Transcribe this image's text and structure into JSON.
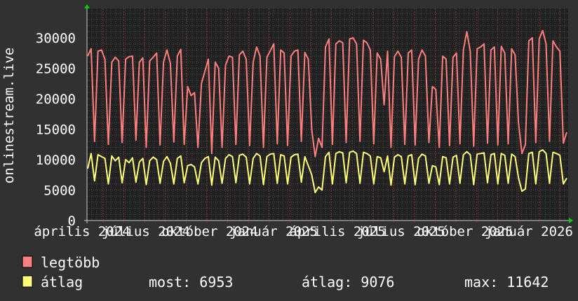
{
  "chart_data": {
    "type": "line",
    "ylabel": "onlinestream.live",
    "ylim": [
      0,
      35000
    ],
    "y_ticks": [
      "0",
      "5000",
      "10000",
      "15000",
      "20000",
      "25000",
      "30000"
    ],
    "x_tick_labels": [
      "április 2024",
      "július 2024",
      "október 2024",
      "január 2025",
      "április 2025",
      "július 2025",
      "október 2025",
      "január 2026"
    ],
    "x_range": [
      "2024-03",
      "2026-03"
    ],
    "grid": true,
    "legend_position": "bottom-left",
    "series": [
      {
        "name": "legtöbb",
        "color": "#ff7f7f",
        "values": [
          27000,
          28200,
          13000,
          27800,
          28000,
          26500,
          12500,
          26000,
          26800,
          26200,
          12800,
          26500,
          26900,
          27000,
          13200,
          26000,
          26700,
          12000,
          26200,
          26800,
          27500,
          12400,
          26000,
          28000,
          25800,
          12900,
          27000,
          28100,
          12500,
          22000,
          20500,
          21000,
          12000,
          22500,
          24500,
          26500,
          11000,
          26000,
          25000,
          12000,
          25500,
          27000,
          26800,
          12500,
          27200,
          27800,
          26500,
          12300,
          26000,
          28500,
          27000,
          12000,
          26800,
          27900,
          29000,
          12600,
          28000,
          27500,
          12300,
          27000,
          27800,
          28000,
          13000,
          27600,
          26500,
          15000,
          10500,
          13500,
          12000,
          28500,
          29800,
          12500,
          29000,
          29500,
          29200,
          12800,
          29800,
          30000,
          29000,
          13000,
          29600,
          29200,
          28000,
          12600,
          27500,
          26500,
          19000,
          27800,
          12000,
          26900,
          27800,
          26800,
          12500,
          27500,
          28000,
          12400,
          26500,
          28000,
          27000,
          12800,
          22000,
          21500,
          12000,
          27000,
          26500,
          12300,
          26800,
          27500,
          12600,
          28000,
          31000,
          27800,
          12200,
          28200,
          28500,
          29000,
          12700,
          28000,
          28500,
          12400,
          28600,
          27500,
          12600,
          28200,
          27200,
          16000,
          11000,
          12500,
          29500,
          30000,
          12800,
          29800,
          31200,
          29000,
          13000,
          29500,
          28500,
          27800,
          12700,
          14500
        ]
      },
      {
        "name": "átlag",
        "color": "#ffff77",
        "values": [
          8500,
          11000,
          6500,
          10800,
          10500,
          10200,
          6000,
          10600,
          9800,
          10400,
          6200,
          10000,
          9500,
          10300,
          6300,
          9600,
          10200,
          5900,
          9800,
          10400,
          10000,
          6100,
          9700,
          10500,
          9400,
          6000,
          10200,
          10600,
          6200,
          9000,
          9200,
          8800,
          6000,
          9500,
          10200,
          10500,
          5800,
          10400,
          9800,
          6100,
          10200,
          10800,
          10500,
          6200,
          10700,
          10900,
          10400,
          6000,
          10200,
          11000,
          10600,
          5900,
          10500,
          10900,
          11000,
          6100,
          10800,
          10600,
          6000,
          10400,
          10800,
          10900,
          6300,
          10500,
          9000,
          7500,
          4600,
          5500,
          5000,
          10500,
          11200,
          6000,
          11000,
          11300,
          11100,
          6200,
          11200,
          11400,
          11000,
          6100,
          11200,
          11000,
          10600,
          6000,
          10500,
          10300,
          8000,
          10600,
          5800,
          10400,
          10800,
          10500,
          6000,
          10600,
          10800,
          5900,
          10200,
          10900,
          10600,
          6100,
          9000,
          8800,
          5900,
          10500,
          10300,
          6000,
          10400,
          10700,
          6100,
          10800,
          11300,
          10800,
          5900,
          10900,
          11000,
          11100,
          6200,
          10800,
          11000,
          6000,
          11000,
          10700,
          6100,
          10900,
          10500,
          7000,
          4800,
          5200,
          11000,
          11200,
          6000,
          11300,
          11600,
          11000,
          6100,
          11200,
          11000,
          10700,
          6000,
          6953
        ]
      }
    ]
  },
  "legend": {
    "items": [
      {
        "label": "legtöbb",
        "color": "#ff7f7f"
      },
      {
        "label": "átlag",
        "color": "#ffff77"
      }
    ],
    "stats": {
      "now": "most: 6953",
      "avg": "átlag: 9076",
      "max": "max: 11642"
    }
  },
  "colors": {
    "background": "#313131",
    "plot_background": "#212121",
    "grid_minor": "#4a4a4a",
    "grid_major": "#7a3434",
    "arrow": "#00d000"
  }
}
